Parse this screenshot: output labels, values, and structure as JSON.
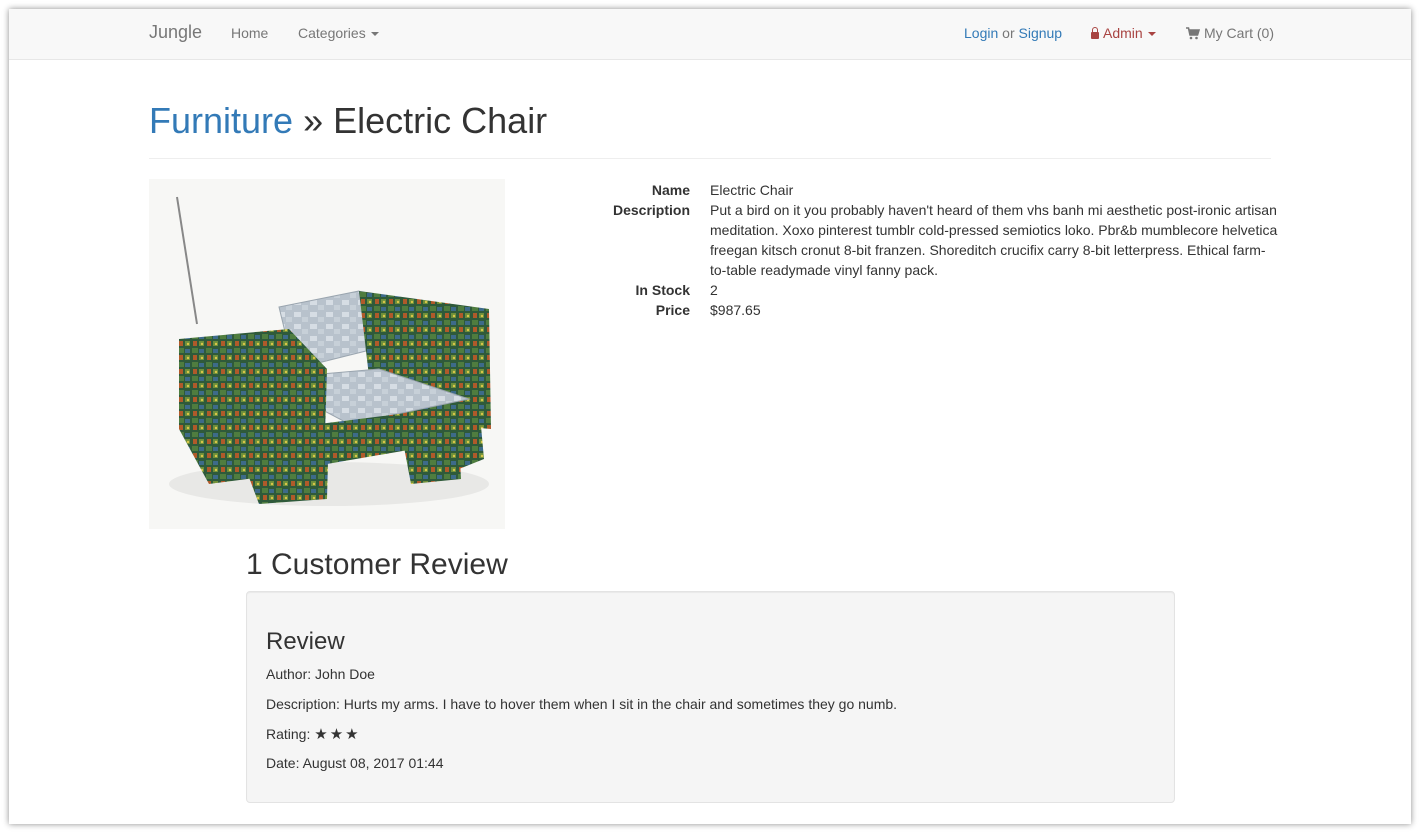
{
  "navbar": {
    "brand": "Jungle",
    "home": "Home",
    "categories": "Categories",
    "login": "Login",
    "or": "or",
    "signup": "Signup",
    "admin": "Admin",
    "cart": "My Cart (0)"
  },
  "header": {
    "category": "Furniture",
    "separator": "»",
    "product": "Electric Chair"
  },
  "details": {
    "name_label": "Name",
    "name": "Electric Chair",
    "description_label": "Description",
    "description": "Put a bird on it you probably haven't heard of them vhs banh mi aesthetic post-ironic artisan meditation. Xoxo pinterest tumblr cold-pressed semiotics loko. Pbr&b mumblecore helvetica freegan kitsch cronut 8-bit franzen. Shoreditch crucifix carry 8-bit letterpress. Ethical farm-to-table readymade vinyl fanny pack.",
    "stock_label": "In Stock",
    "stock": "2",
    "price_label": "Price",
    "price": "$987.65"
  },
  "reviews": {
    "title": "1 Customer Review",
    "items": [
      {
        "heading": "Review",
        "author": "Author: John Doe",
        "description": "Description: Hurts my arms. I have to hover them when I sit in the chair and sometimes they go numb.",
        "rating_label": "Rating:",
        "rating": 3,
        "date": "Date: August 08, 2017 01:44"
      }
    ]
  },
  "colors": {
    "link": "#337ab7",
    "admin": "#a94442",
    "navbar_bg": "#f8f8f8",
    "well_bg": "#f5f5f5"
  }
}
